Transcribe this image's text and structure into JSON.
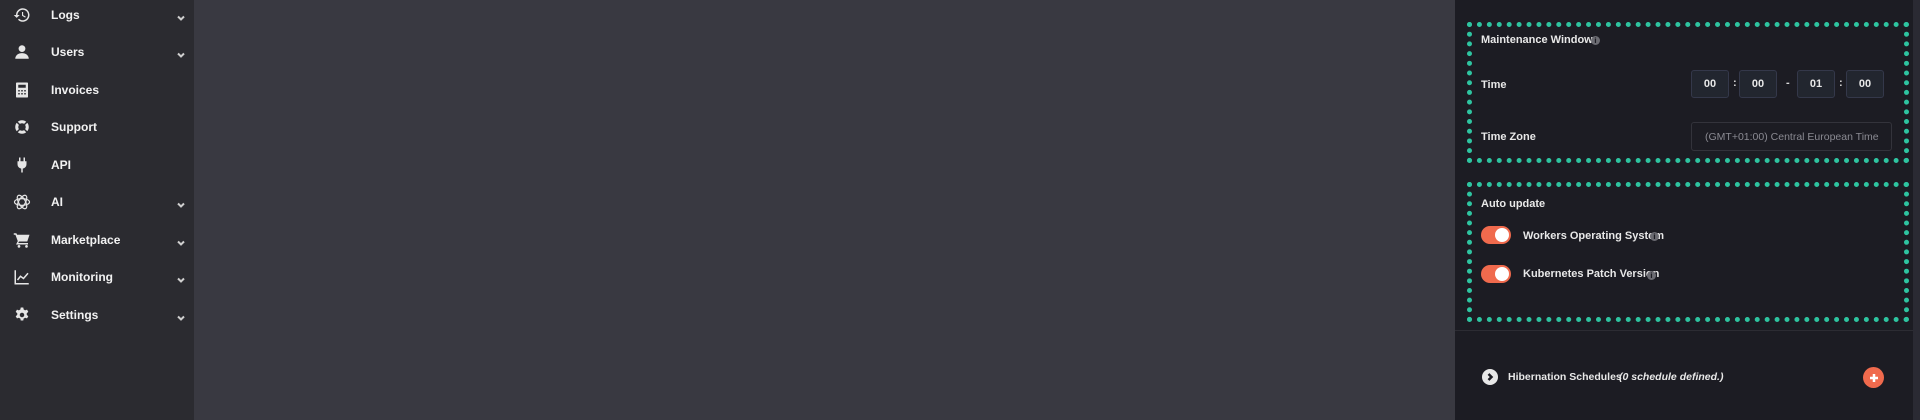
{
  "sidebar": {
    "items": [
      {
        "label": "Logs",
        "icon": "history-icon",
        "has_chevron": true
      },
      {
        "label": "Users",
        "icon": "user-icon",
        "has_chevron": true
      },
      {
        "label": "Invoices",
        "icon": "calculator-icon",
        "has_chevron": false
      },
      {
        "label": "Support",
        "icon": "lifebuoy-icon",
        "has_chevron": false
      },
      {
        "label": "API",
        "icon": "plug-icon",
        "has_chevron": false
      },
      {
        "label": "AI",
        "icon": "ai-icon",
        "has_chevron": true
      },
      {
        "label": "Marketplace",
        "icon": "cart-icon",
        "has_chevron": true
      },
      {
        "label": "Monitoring",
        "icon": "chart-line-icon",
        "has_chevron": true
      },
      {
        "label": "Settings",
        "icon": "gear-icon",
        "has_chevron": true
      }
    ]
  },
  "maintenance": {
    "title": "Maintenance Window",
    "time_label": "Time",
    "start_hour": "00",
    "start_minute": "00",
    "range_separator": "-",
    "end_hour": "01",
    "end_minute": "00",
    "time_separator": ":",
    "timezone_label": "Time Zone",
    "timezone_value": "(GMT+01:00) Central European Time"
  },
  "auto_update": {
    "title": "Auto update",
    "workers_os_label": "Workers Operating System",
    "workers_os_enabled": true,
    "k8s_patch_label": "Kubernetes Patch Version",
    "k8s_patch_enabled": true
  },
  "hibernation": {
    "label": "Hibernation Schedules",
    "count_text": "(0 schedule defined.)"
  },
  "colors": {
    "accent": "#f06a4d",
    "highlight_border": "#2ec4a0",
    "panel_bg": "#1c1c23",
    "sidebar_bg": "#2b2b30",
    "main_bg": "#393941"
  }
}
